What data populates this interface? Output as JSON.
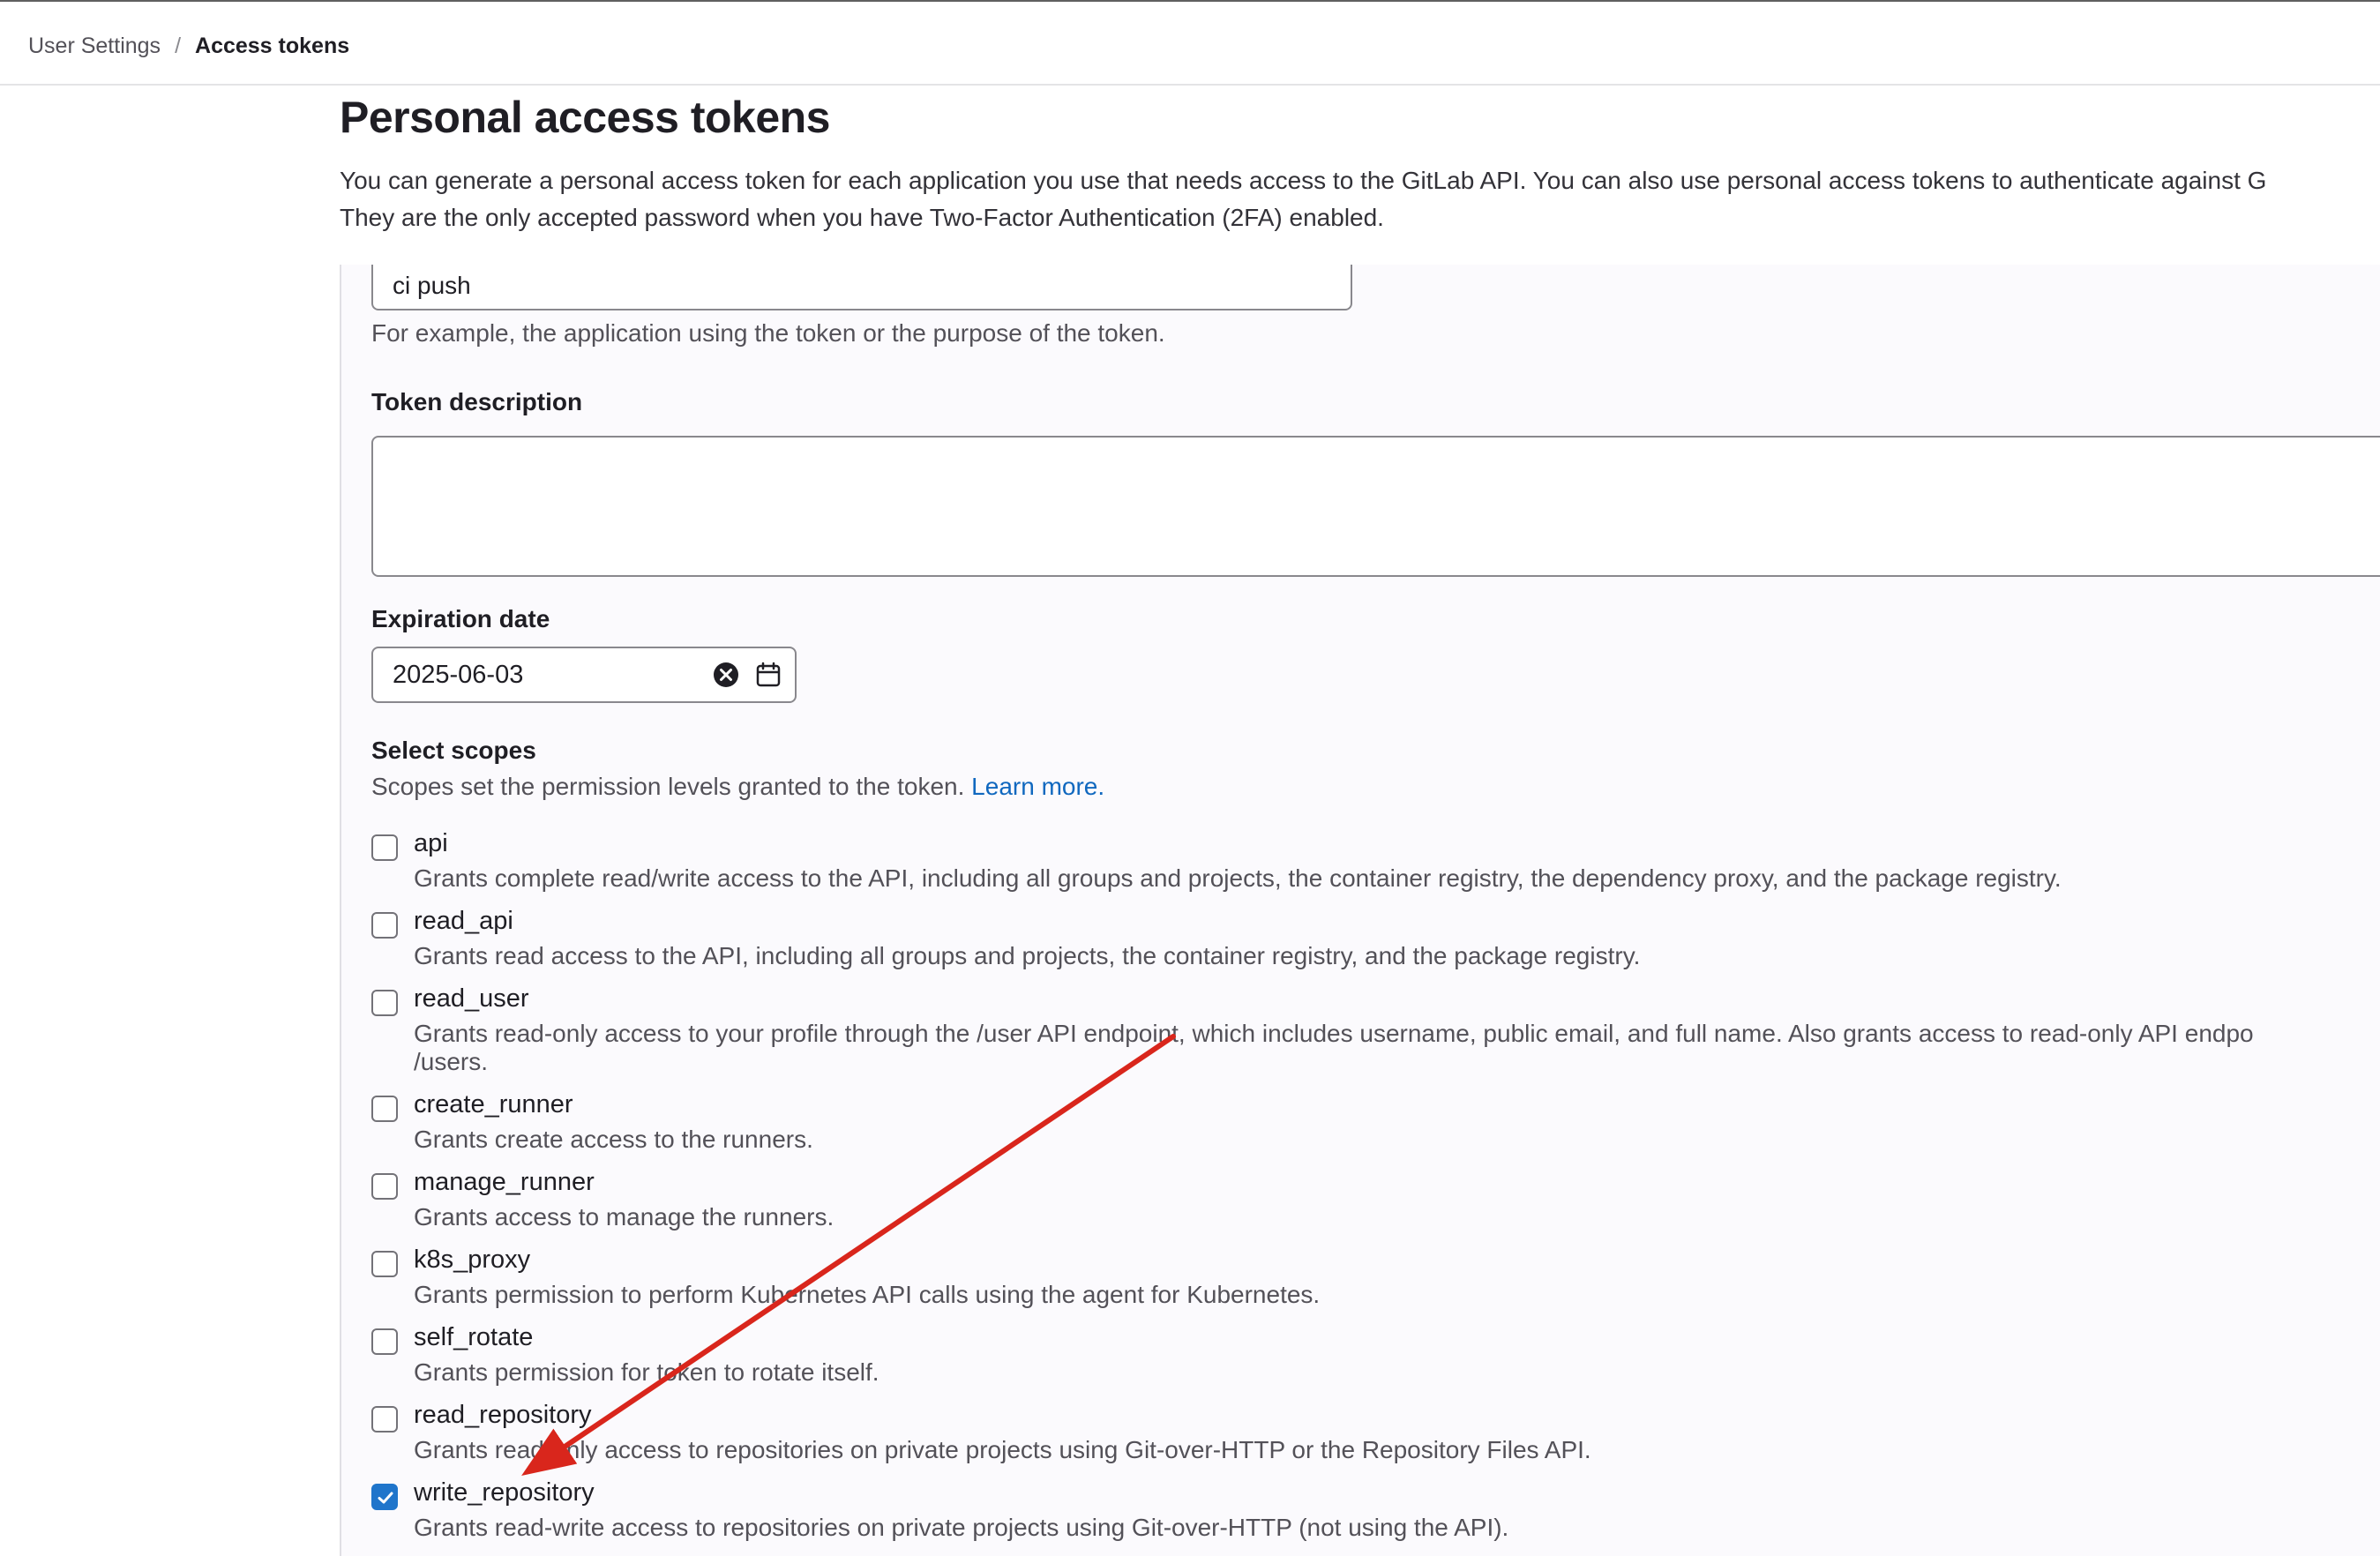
{
  "breadcrumb": {
    "parent": "User Settings",
    "separator": "/",
    "current": "Access tokens"
  },
  "page": {
    "title": "Personal access tokens",
    "description_line1": "You can generate a personal access token for each application you use that needs access to the GitLab API. You can also use personal access tokens to authenticate against G",
    "description_line2": "They are the only accepted password when you have Two-Factor Authentication (2FA) enabled."
  },
  "form": {
    "token_name_value": "ci push",
    "token_name_help": "For example, the application using the token or the purpose of the token.",
    "description_label": "Token description",
    "description_value": "",
    "expiration_label": "Expiration date",
    "expiration_value": "2025-06-03",
    "scopes_label": "Select scopes",
    "scopes_help": "Scopes set the permission levels granted to the token.",
    "learn_more": "Learn more."
  },
  "scopes": [
    {
      "name": "api",
      "checked": false,
      "description": "Grants complete read/write access to the API, including all groups and projects, the container registry, the dependency proxy, and the package registry."
    },
    {
      "name": "read_api",
      "checked": false,
      "description": "Grants read access to the API, including all groups and projects, the container registry, and the package registry."
    },
    {
      "name": "read_user",
      "checked": false,
      "description": "Grants read-only access to your profile through the /user API endpoint, which includes username, public email, and full name. Also grants access to read-only API endpo",
      "description_2": "/users."
    },
    {
      "name": "create_runner",
      "checked": false,
      "description": "Grants create access to the runners."
    },
    {
      "name": "manage_runner",
      "checked": false,
      "description": "Grants access to manage the runners."
    },
    {
      "name": "k8s_proxy",
      "checked": false,
      "description": "Grants permission to perform Kubernetes API calls using the agent for Kubernetes."
    },
    {
      "name": "self_rotate",
      "checked": false,
      "description": "Grants permission for token to rotate itself."
    },
    {
      "name": "read_repository",
      "checked": false,
      "description": "Grants read-only access to repositories on private projects using Git-over-HTTP or the Repository Files API."
    },
    {
      "name": "write_repository",
      "checked": true,
      "description": "Grants read-write access to repositories on private projects using Git-over-HTTP (not using the API)."
    }
  ],
  "colors": {
    "accent": "#1f75cb",
    "link": "#1068bf",
    "annotation_arrow": "#d9261c"
  },
  "icons": {
    "clear": "clear-icon",
    "calendar": "calendar-icon",
    "check": "check-icon",
    "annotation": "arrow-annotation"
  }
}
